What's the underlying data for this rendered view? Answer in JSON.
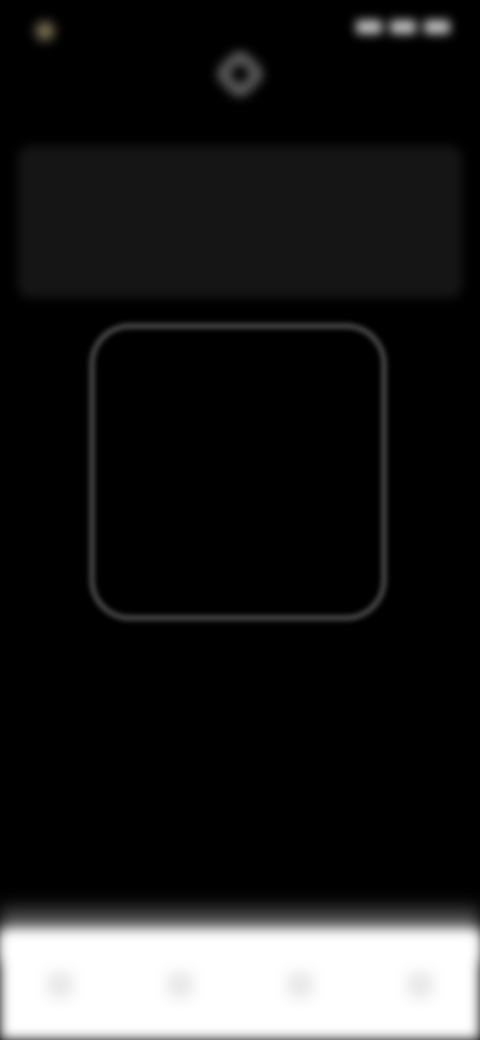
{
  "status_bar": {
    "time": "",
    "icon_names": [
      "signal-icon",
      "wifi-icon",
      "battery-icon"
    ]
  },
  "top": {
    "icon": "camera-scan-icon"
  },
  "info_card": {
    "title": "",
    "body": "",
    "action_label": ""
  },
  "viewfinder": {
    "label": ""
  },
  "bottom_nav": {
    "items": [
      {
        "label": "",
        "icon": "nav-icon-1"
      },
      {
        "label": "",
        "icon": "nav-icon-2"
      },
      {
        "label": "",
        "icon": "nav-icon-3"
      },
      {
        "label": "",
        "icon": "nav-icon-4"
      }
    ]
  },
  "colors": {
    "background": "#000000",
    "card": "#151515",
    "frame": "#bcbcbc",
    "bottom_panel": "#ffffff"
  }
}
